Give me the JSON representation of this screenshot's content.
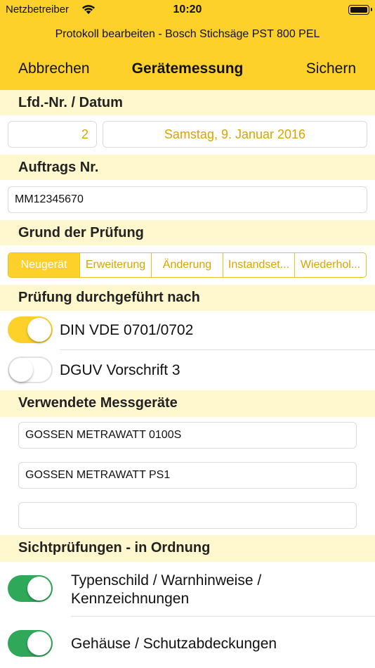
{
  "status": {
    "carrier": "Netzbetreiber",
    "time": "10:20"
  },
  "header": {
    "subtitle": "Protokoll bearbeiten - Bosch Stichsäge PST 800 PEL"
  },
  "nav": {
    "cancel": "Abbrechen",
    "title": "Gerätemessung",
    "save": "Sichern"
  },
  "lfd": {
    "label": "Lfd.-Nr. / Datum",
    "number": "2",
    "date": "Samstag, 9. Januar 2016"
  },
  "auftrag": {
    "label": "Auftrags Nr.",
    "value": "MM12345670"
  },
  "grund": {
    "label": "Grund der Prüfung",
    "options": [
      "Neugerät",
      "Erweiterung",
      "Änderung",
      "Instandset...",
      "Wiederhol..."
    ],
    "selected": "Neugerät"
  },
  "pruefung": {
    "label": "Prüfung durchgeführt nach",
    "items": [
      {
        "label": "DIN VDE 0701/0702",
        "on": true
      },
      {
        "label": "DGUV Vorschrift 3",
        "on": false
      }
    ]
  },
  "messgeraete": {
    "label": "Verwendete Messgeräte",
    "items": [
      "GOSSEN METRAWATT 0100S",
      "GOSSEN METRAWATT PS1",
      ""
    ]
  },
  "sicht": {
    "label": "Sichtprüfungen - in Ordnung",
    "items": [
      {
        "line1": "Typenschild / Warnhinweise /",
        "line2": "Kennzeichnungen",
        "on": true
      },
      {
        "line1": "Gehäuse / Schutzabdeckungen",
        "on": true
      }
    ]
  },
  "colors": {
    "accent": "#fdd12a",
    "section_bg": "#fff7cd",
    "gold_text": "#d9a500",
    "toggle_green": "#2fa85a"
  }
}
